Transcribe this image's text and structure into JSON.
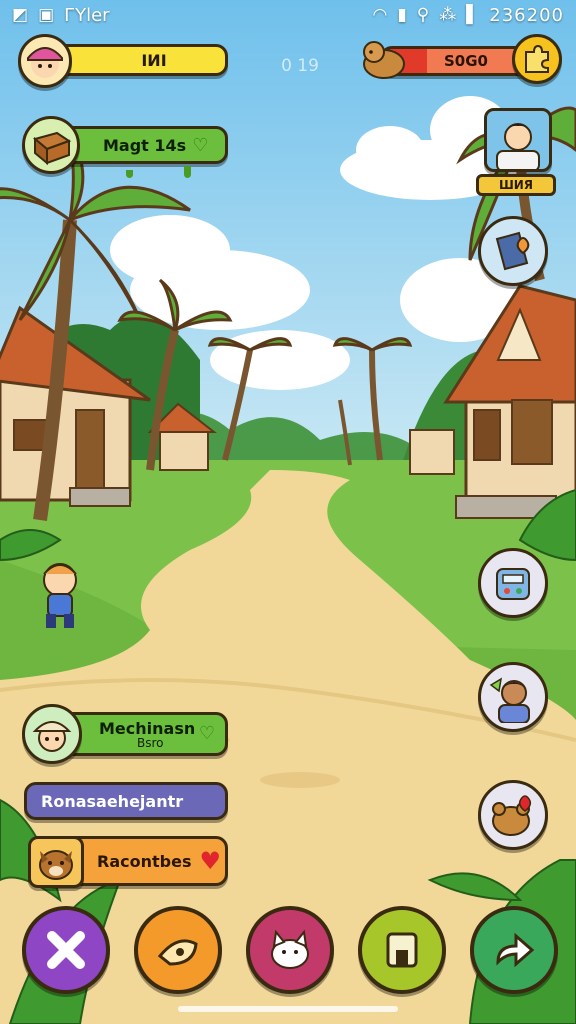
{
  "statusbar": {
    "left_icon": "image-icon",
    "app_icon": "building-icon",
    "carrier": "ГYler",
    "wifi_icon": "wifi-icon",
    "signal_icon": "signal-icon",
    "notif_icon": "notification-icon",
    "data_icon": "data-icon",
    "battery_icon": "battery-icon",
    "time": "236200"
  },
  "hud": {
    "player_value": "ІИІ",
    "timer": "0 19",
    "coins": "S0G0",
    "magic_label": "Magt 14s"
  },
  "right_panel": {
    "profile_label": "ШИЯ"
  },
  "bottom_left": {
    "mech_title": "Mechinasn",
    "mech_sub": "Bsro",
    "violet_label": "Ronasaehejantr",
    "orange_label": "Racontbes"
  },
  "toolbar": {
    "close_icon": "close-icon",
    "cheese_icon": "cheese-icon",
    "cat_icon": "cat-icon",
    "inventory_icon": "inventory-icon",
    "next_icon": "arrow-right-icon"
  },
  "colors": {
    "sky": "#8fd0ef",
    "grass": "#7cc24a",
    "path": "#f2d898",
    "accent_yellow": "#f9e33a",
    "accent_green": "#6cbf3c",
    "accent_purple": "#8e46c4"
  }
}
